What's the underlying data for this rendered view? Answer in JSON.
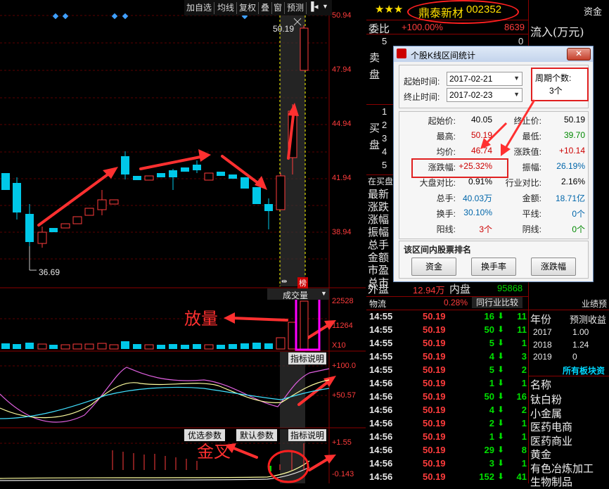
{
  "stock": {
    "stars": "★★★",
    "name": "鼎泰新材",
    "code": "002352",
    "top_right": "资金"
  },
  "toolbar": [
    "加自选",
    "均线",
    "复权",
    "叠",
    "窗",
    "预测"
  ],
  "price_axis": [
    "50.94",
    "47.94",
    "44.94",
    "41.94",
    "38.94"
  ],
  "volume_axis": [
    "22528",
    "11264",
    "X10"
  ],
  "indicator_axis": [
    "+100.0",
    "+50.57"
  ],
  "indicator2_axis": [
    "+1.55",
    "-0.143"
  ],
  "annotations": {
    "high_label": "50.19",
    "low_label": "36.69",
    "volume_note": "放量",
    "cross_note": "金叉",
    "range_badge": "榜"
  },
  "panel_labels": {
    "volume": "成交量",
    "indicator_btn1": "指标说明",
    "opt_param": "优选参数",
    "default_param": "默认参数",
    "indicator_btn2": "指标说明"
  },
  "order_book": {
    "weibi_label": "委比",
    "weibi_value": "+100.00%",
    "weibi_num": "8639",
    "sell_label": "卖盘",
    "buy_label": "买盘",
    "sell_levels": [
      {
        "lvl": "5",
        "vol": "0"
      },
      {
        "lvl": "4",
        "vol": ""
      },
      {
        "lvl": "3",
        "vol": ""
      },
      {
        "lvl": "2",
        "vol": ""
      },
      {
        "lvl": "1",
        "vol": ""
      }
    ],
    "buy_levels": [
      {
        "lvl": "1"
      },
      {
        "lvl": "2"
      },
      {
        "lvl": "3"
      },
      {
        "lvl": "4"
      },
      {
        "lvl": "5"
      }
    ]
  },
  "left_stats": [
    "在买盘",
    "最新",
    "涨跌",
    "涨幅",
    "振幅",
    "总手",
    "金额",
    "市盈",
    "总市"
  ],
  "waipan": {
    "label": "外盘",
    "value": "12.94万",
    "neipan_label": "内盘",
    "neipan_value": "95868"
  },
  "liquidity": {
    "label": "物流",
    "pct": "0.28%",
    "compare": "同行业比较"
  },
  "ticks": [
    {
      "time": "14:55",
      "price": "50.19",
      "vol": "16",
      "dir": "down",
      "n": "11"
    },
    {
      "time": "14:55",
      "price": "50.19",
      "vol": "50",
      "dir": "down",
      "n": "11"
    },
    {
      "time": "14:55",
      "price": "50.19",
      "vol": "5",
      "dir": "down",
      "n": "1"
    },
    {
      "time": "14:55",
      "price": "50.19",
      "vol": "4",
      "dir": "down",
      "n": "3"
    },
    {
      "time": "14:55",
      "price": "50.19",
      "vol": "5",
      "dir": "down",
      "n": "2"
    },
    {
      "time": "14:56",
      "price": "50.19",
      "vol": "1",
      "dir": "down",
      "n": "1"
    },
    {
      "time": "14:56",
      "price": "50.19",
      "vol": "50",
      "dir": "down",
      "n": "16"
    },
    {
      "time": "14:56",
      "price": "50.19",
      "vol": "4",
      "dir": "down",
      "n": "2"
    },
    {
      "time": "14:56",
      "price": "50.19",
      "vol": "2",
      "dir": "down",
      "n": "1"
    },
    {
      "time": "14:56",
      "price": "50.19",
      "vol": "1",
      "dir": "down",
      "n": "1"
    },
    {
      "time": "14:56",
      "price": "50.19",
      "vol": "29",
      "dir": "down",
      "n": "8"
    },
    {
      "time": "14:56",
      "price": "50.19",
      "vol": "3",
      "dir": "down",
      "n": "1"
    },
    {
      "time": "14:56",
      "price": "50.19",
      "vol": "152",
      "dir": "down",
      "n": "41"
    }
  ],
  "right_panel": {
    "flow_label": "流入(万元)",
    "forecast_title": "业绩预",
    "col_year": "年份",
    "col_eps": "预测收益",
    "rows": [
      {
        "year": "2017",
        "eps": "1.00"
      },
      {
        "year": "2018",
        "eps": "1.24"
      },
      {
        "year": "2019",
        "eps": "0"
      }
    ],
    "sectors_title": "所有板块资",
    "sectors_col": "名称",
    "sectors": [
      "钛白粉",
      "小金属",
      "医药电商",
      "医药商业",
      "黄金",
      "有色冶炼加工",
      "生物制品"
    ]
  },
  "dialog": {
    "title": "个股K线区间统计",
    "start_label": "起始时间:",
    "start_value": "2017-02-21",
    "end_label": "终止时间:",
    "end_value": "2017-02-23",
    "period_label": "周期个数:",
    "period_value": "3个",
    "stats_left": [
      {
        "label": "起始价:",
        "value": "40.05"
      },
      {
        "label": "最高:",
        "value": "50.19"
      },
      {
        "label": "均价:",
        "value": "46.74"
      },
      {
        "label": "涨跌幅:",
        "value": "+25.32%"
      },
      {
        "label": "大盘对比:",
        "value": "0.91%"
      },
      {
        "label": "总手:",
        "value": "40.03万"
      },
      {
        "label": "换手:",
        "value": "30.10%"
      },
      {
        "label": "阳线:",
        "value": "3个"
      }
    ],
    "stats_right": [
      {
        "label": "终止价:",
        "value": "50.19"
      },
      {
        "label": "最低:",
        "value": "39.70"
      },
      {
        "label": "涨跌值:",
        "value": "+10.14"
      },
      {
        "label": "振幅:",
        "value": "26.19%"
      },
      {
        "label": "行业对比:",
        "value": "2.16%"
      },
      {
        "label": "金额:",
        "value": "18.71亿"
      },
      {
        "label": "平线:",
        "value": "0个"
      },
      {
        "label": "阴线:",
        "value": "0个"
      }
    ],
    "rank_title": "该区间内股票排名",
    "rank_buttons": [
      "资金",
      "换手率",
      "涨跌幅"
    ]
  }
}
